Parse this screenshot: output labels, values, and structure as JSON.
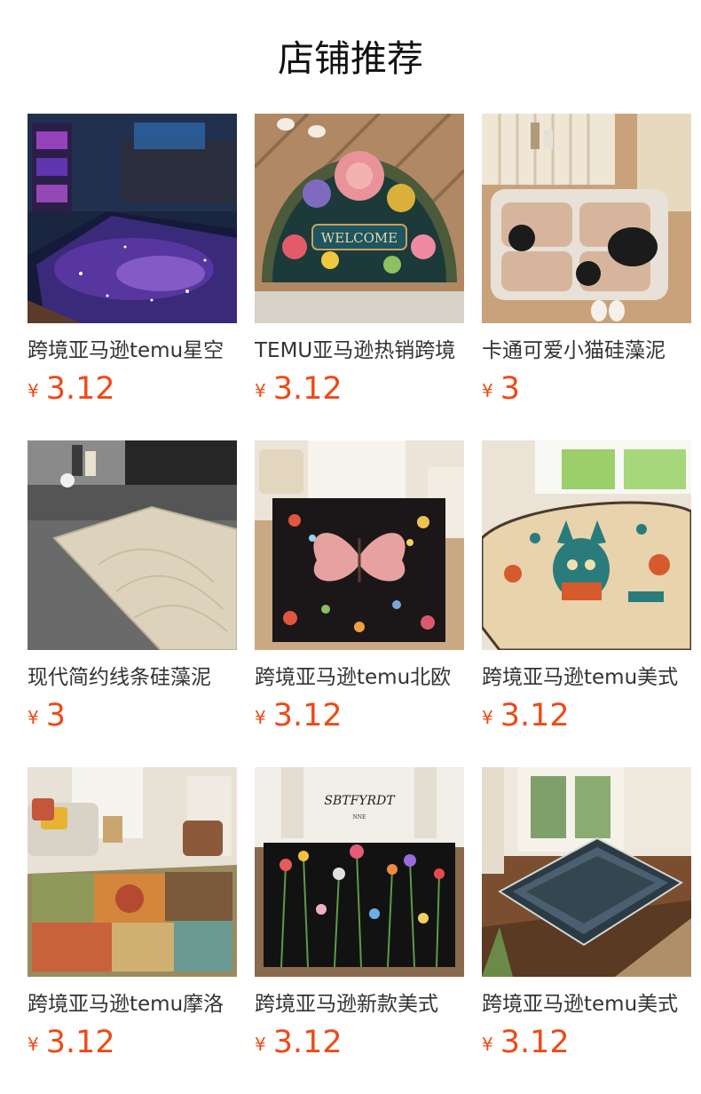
{
  "header": {
    "title": "店铺推荐"
  },
  "currency_symbol": "¥",
  "products": [
    {
      "name": "跨境亚马逊temu星空",
      "price": "3.12",
      "image": "galaxy-gaming-room-rug"
    },
    {
      "name": "TEMU亚马逊热销跨境",
      "price": "3.12",
      "image": "welcome-floral-half-round-mat"
    },
    {
      "name": "卡通可爱小猫硅藻泥",
      "price": "3",
      "image": "cartoon-cat-diatomite-mat"
    },
    {
      "name": "现代简约线条硅藻泥",
      "price": "3",
      "image": "modern-line-diatomite-mat"
    },
    {
      "name": "跨境亚马逊temu北欧",
      "price": "3.12",
      "image": "butterfly-floral-black-rug"
    },
    {
      "name": "跨境亚马逊temu美式",
      "price": "3.12",
      "image": "tribal-cat-half-round-mat"
    },
    {
      "name": "跨境亚马逊temu摩洛",
      "price": "3.12",
      "image": "patchwork-moroccan-rug"
    },
    {
      "name": "跨境亚马逊新款美式",
      "price": "3.12",
      "image": "wildflower-black-door-mat",
      "image_text": {
        "brand": "SBTFYRDT",
        "sub": "NNE"
      }
    },
    {
      "name": "跨境亚马逊temu美式",
      "price": "3.12",
      "image": "vintage-persian-door-mat"
    }
  ]
}
